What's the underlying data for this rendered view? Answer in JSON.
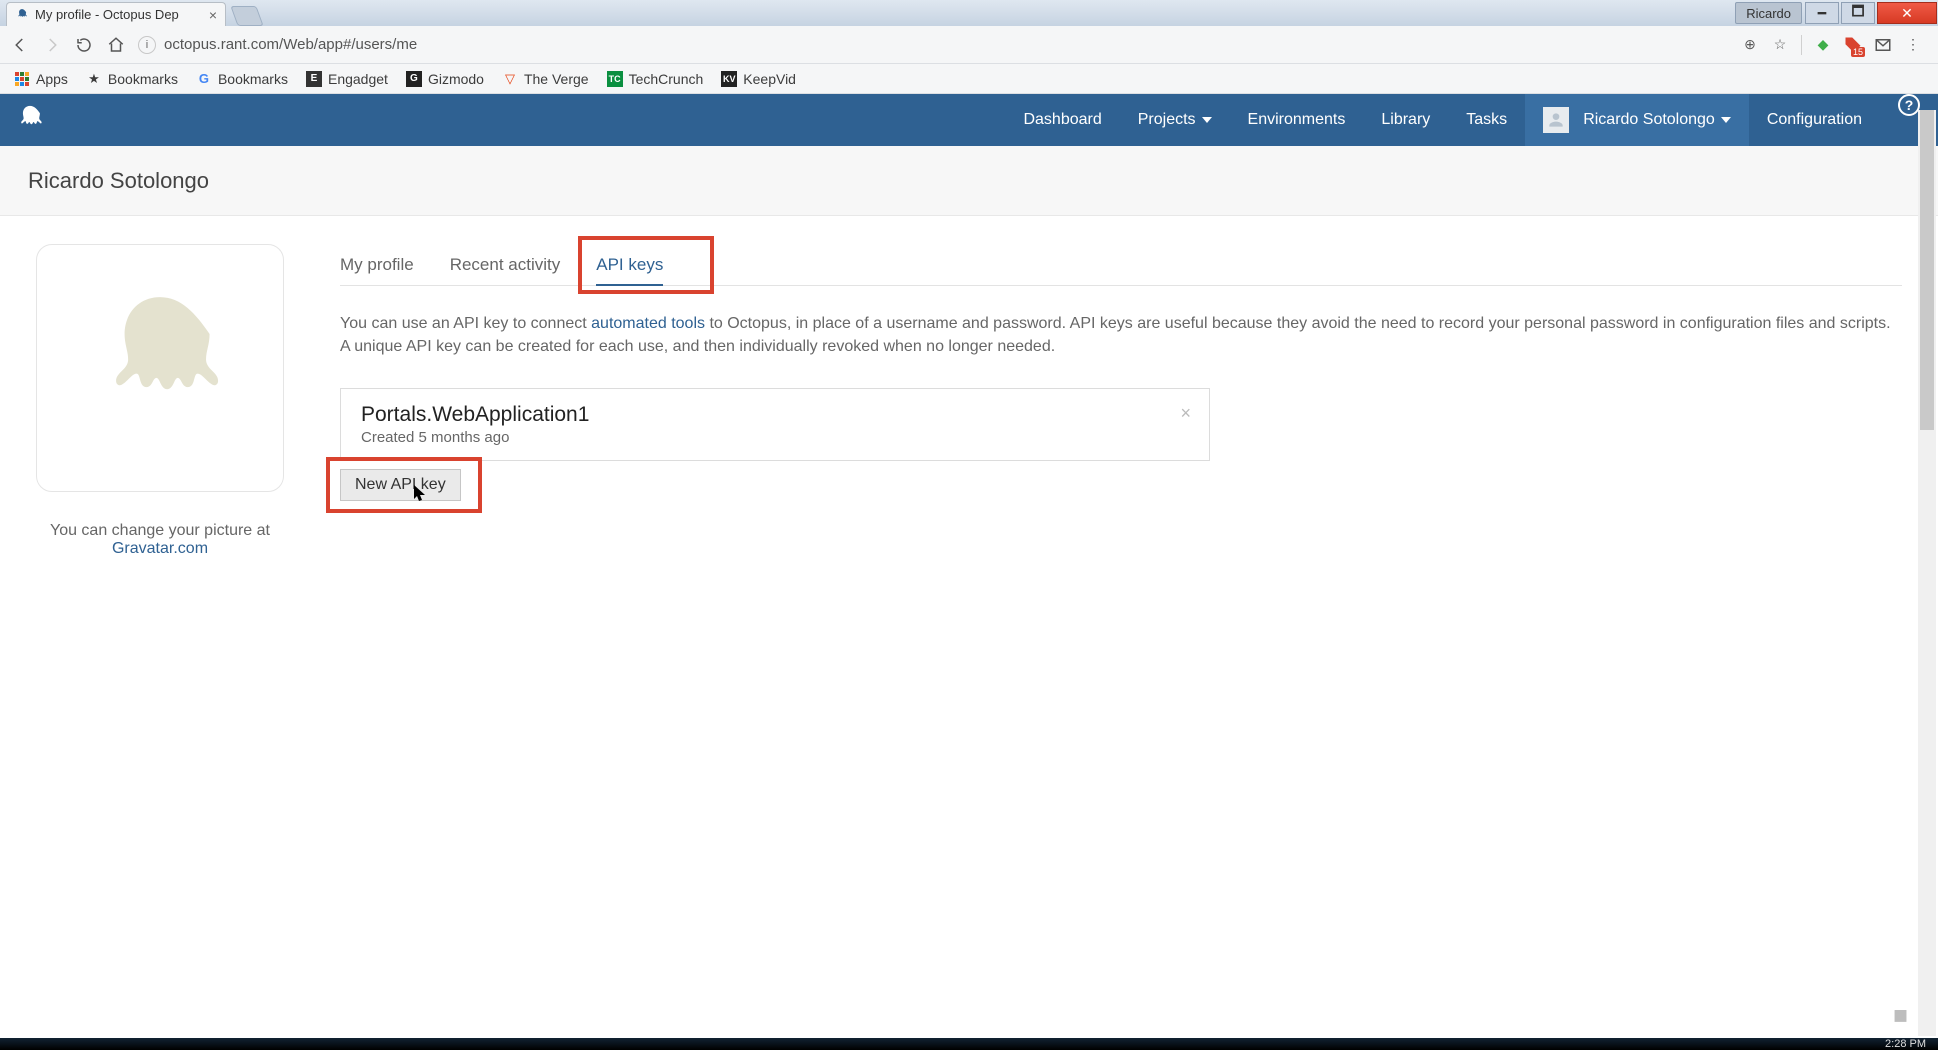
{
  "window": {
    "user_badge": "Ricardo",
    "tab_title": "My profile - Octopus Dep",
    "url": "octopus.rant.com/Web/app#/users/me"
  },
  "bookmarks": {
    "apps": "Apps",
    "items": [
      "Bookmarks",
      "Bookmarks",
      "Engadget",
      "Gizmodo",
      "The Verge",
      "TechCrunch",
      "KeepVid"
    ]
  },
  "nav": {
    "dashboard": "Dashboard",
    "projects": "Projects",
    "environments": "Environments",
    "library": "Library",
    "tasks": "Tasks",
    "user": "Ricardo Sotolongo",
    "configuration": "Configuration"
  },
  "page": {
    "title": "Ricardo Sotolongo",
    "avatar_hint_prefix": "You can change your picture at",
    "avatar_link": "Gravatar.com"
  },
  "tabs": {
    "my_profile": "My profile",
    "recent_activity": "Recent activity",
    "api_keys": "API keys"
  },
  "description": {
    "pre": "You can use an API key to connect ",
    "link": "automated tools",
    "post": " to Octopus, in place of a username and password. API keys are useful because they avoid the need to record your personal password in configuration files and scripts. A unique API key can be created for each use, and then individually revoked when no longer needed."
  },
  "api_keys": [
    {
      "name": "Portals.WebApplication1",
      "created": "Created 5 months ago"
    }
  ],
  "buttons": {
    "new_api_key": "New API key"
  },
  "taskbar": {
    "clock": "2:28 PM"
  }
}
